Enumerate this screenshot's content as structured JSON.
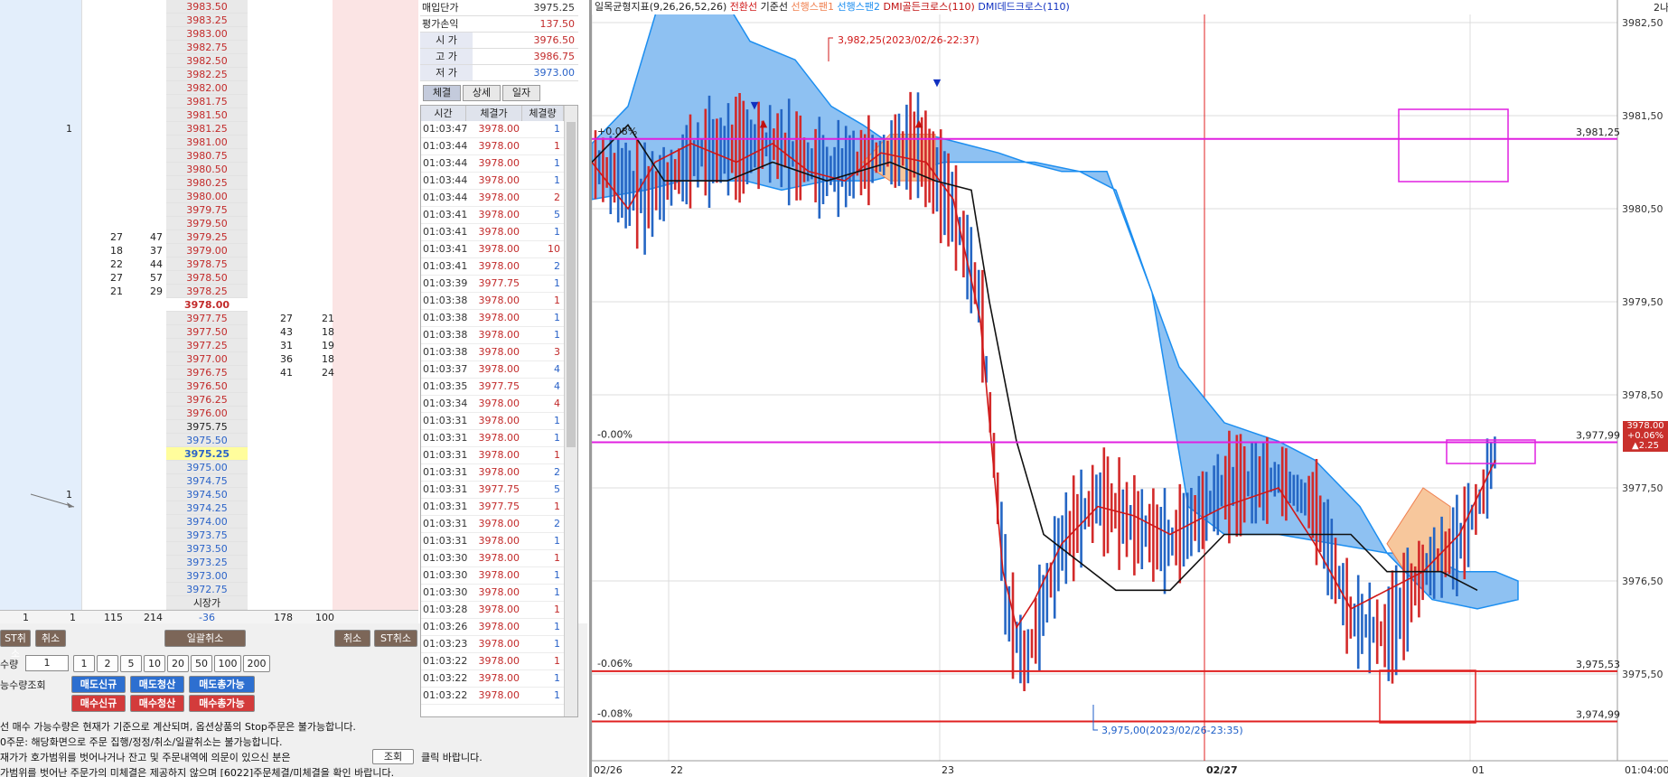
{
  "book": {
    "rows": [
      {
        "price": "3983.50",
        "cls": "ask"
      },
      {
        "price": "3983.25",
        "cls": "ask"
      },
      {
        "price": "3983.00",
        "cls": "ask"
      },
      {
        "price": "3982.75",
        "cls": "ask"
      },
      {
        "price": "3982.50",
        "cls": "ask"
      },
      {
        "price": "3982.25",
        "cls": "ask"
      },
      {
        "price": "3982.00",
        "cls": "ask"
      },
      {
        "price": "3981.75",
        "cls": "ask"
      },
      {
        "price": "3981.50",
        "cls": "ask"
      },
      {
        "price": "3981.25",
        "cls": "ask",
        "a": "1"
      },
      {
        "price": "3981.00",
        "cls": "ask"
      },
      {
        "price": "3980.75",
        "cls": "ask"
      },
      {
        "price": "3980.50",
        "cls": "ask"
      },
      {
        "price": "3980.25",
        "cls": "ask"
      },
      {
        "price": "3980.00",
        "cls": "ask"
      },
      {
        "price": "3979.75",
        "cls": "ask"
      },
      {
        "price": "3979.50",
        "cls": "ask"
      },
      {
        "price": "3979.25",
        "cls": "ask",
        "c": "27",
        "d": "47"
      },
      {
        "price": "3979.00",
        "cls": "ask",
        "c": "18",
        "d": "37"
      },
      {
        "price": "3978.75",
        "cls": "ask",
        "c": "22",
        "d": "44"
      },
      {
        "price": "3978.50",
        "cls": "ask",
        "c": "27",
        "d": "57"
      },
      {
        "price": "3978.25",
        "cls": "ask",
        "c": "21",
        "d": "29"
      },
      {
        "price": "3978.00",
        "cls": "cur"
      },
      {
        "price": "3977.75",
        "cls": "ask",
        "e": "27",
        "f": "21"
      },
      {
        "price": "3977.50",
        "cls": "ask",
        "e": "43",
        "f": "18"
      },
      {
        "price": "3977.25",
        "cls": "ask",
        "e": "31",
        "f": "19"
      },
      {
        "price": "3977.00",
        "cls": "ask",
        "e": "36",
        "f": "18"
      },
      {
        "price": "3976.75",
        "cls": "ask",
        "e": "41",
        "f": "24"
      },
      {
        "price": "3976.50",
        "cls": "ask"
      },
      {
        "price": "3976.25",
        "cls": "ask"
      },
      {
        "price": "3976.00",
        "cls": "ask"
      },
      {
        "price": "3975.75",
        "cls": "plain"
      },
      {
        "price": "3975.50",
        "cls": "bid"
      },
      {
        "price": "3975.25",
        "cls": "avg"
      },
      {
        "price": "3975.00",
        "cls": "bid"
      },
      {
        "price": "3974.75",
        "cls": "bid"
      },
      {
        "price": "3974.50",
        "cls": "bid",
        "a": "1"
      },
      {
        "price": "3974.25",
        "cls": "bid"
      },
      {
        "price": "3974.00",
        "cls": "bid"
      },
      {
        "price": "3973.75",
        "cls": "bid"
      },
      {
        "price": "3973.50",
        "cls": "bid"
      },
      {
        "price": "3973.25",
        "cls": "bid"
      },
      {
        "price": "3973.00",
        "cls": "bid"
      },
      {
        "price": "3972.75",
        "cls": "bid"
      },
      {
        "price": "시장가",
        "cls": "plain"
      }
    ],
    "totals": {
      "a": "1",
      "b": "1",
      "c": "115",
      "d": "214",
      "price": "-36",
      "e": "178",
      "f": "100"
    },
    "colors": {
      "ask": "#c22a2a",
      "bid": "#2b63c8",
      "avg_bg": "#fffd9c",
      "cur": "#c22a2a"
    }
  },
  "quote": {
    "rows": [
      {
        "k": "매입단가",
        "v": "3975.25",
        "color": "#333",
        "plainkey": true
      },
      {
        "k": "평가손익",
        "v": "137.50",
        "color": "#c22a2a",
        "plainkey": true
      },
      {
        "k": "시  가",
        "v": "3976.50",
        "color": "#c22a2a"
      },
      {
        "k": "고  가",
        "v": "3986.75",
        "color": "#c22a2a"
      },
      {
        "k": "저  가",
        "v": "3973.00",
        "color": "#2b63c8"
      }
    ],
    "tabs": [
      "체결",
      "상세",
      "일자"
    ]
  },
  "ticks": {
    "headers": [
      "시간",
      "체결가",
      "체결량"
    ],
    "rows": [
      [
        "01:03:47",
        "3978.00",
        "1"
      ],
      [
        "01:03:44",
        "3978.00",
        "1"
      ],
      [
        "01:03:44",
        "3978.00",
        "1"
      ],
      [
        "01:03:44",
        "3978.00",
        "1"
      ],
      [
        "01:03:44",
        "3978.00",
        "2"
      ],
      [
        "01:03:41",
        "3978.00",
        "5"
      ],
      [
        "01:03:41",
        "3978.00",
        "1"
      ],
      [
        "01:03:41",
        "3978.00",
        "10"
      ],
      [
        "01:03:41",
        "3978.00",
        "2"
      ],
      [
        "01:03:39",
        "3977.75",
        "1"
      ],
      [
        "01:03:38",
        "3978.00",
        "1"
      ],
      [
        "01:03:38",
        "3978.00",
        "1"
      ],
      [
        "01:03:38",
        "3978.00",
        "1"
      ],
      [
        "01:03:38",
        "3978.00",
        "3"
      ],
      [
        "01:03:37",
        "3978.00",
        "4"
      ],
      [
        "01:03:35",
        "3977.75",
        "4"
      ],
      [
        "01:03:34",
        "3978.00",
        "4"
      ],
      [
        "01:03:31",
        "3978.00",
        "1"
      ],
      [
        "01:03:31",
        "3978.00",
        "1"
      ],
      [
        "01:03:31",
        "3978.00",
        "1"
      ],
      [
        "01:03:31",
        "3978.00",
        "2"
      ],
      [
        "01:03:31",
        "3977.75",
        "5"
      ],
      [
        "01:03:31",
        "3977.75",
        "1"
      ],
      [
        "01:03:31",
        "3978.00",
        "2"
      ],
      [
        "01:03:31",
        "3978.00",
        "1"
      ],
      [
        "01:03:30",
        "3978.00",
        "1"
      ],
      [
        "01:03:30",
        "3978.00",
        "1"
      ],
      [
        "01:03:30",
        "3978.00",
        "1"
      ],
      [
        "01:03:28",
        "3978.00",
        "1"
      ],
      [
        "01:03:26",
        "3978.00",
        "1"
      ],
      [
        "01:03:23",
        "3978.00",
        "1"
      ],
      [
        "01:03:22",
        "3978.00",
        "1"
      ],
      [
        "01:03:22",
        "3978.00",
        "1"
      ],
      [
        "01:03:22",
        "3978.00",
        "1"
      ]
    ],
    "blue_vols": [
      "1",
      "1",
      "1",
      "1",
      "2",
      "5",
      "1",
      "10",
      "2",
      "1",
      "1",
      "1",
      "1",
      "3",
      "4",
      "4",
      "4",
      "1",
      "1",
      "1",
      "2",
      "5",
      "1",
      "2",
      "1",
      "1",
      "1",
      "1",
      "1",
      "1",
      "1",
      "1",
      "1",
      "1"
    ]
  },
  "controls": {
    "cancel_st_left": "ST취소",
    "cancel_left": "취소",
    "cancel_all": "일괄취소",
    "cancel_right": "취소",
    "cancel_st_right": "ST취소",
    "qty_label": "수량",
    "qty_value": "1",
    "qty_presets": [
      "1",
      "2",
      "5",
      "10",
      "20",
      "50",
      "100",
      "200"
    ],
    "avail_label": "능수량조회",
    "sell_new": "매도신규",
    "sell_close": "매도청산",
    "sell_avail": "매도총가능",
    "buy_new": "매수신규",
    "buy_close": "매수청산",
    "buy_avail": "매수총가능",
    "lookup": "조회",
    "notes": [
      "선 매수 가능수량은 현재가 기준으로 계산되며, 옵션상품의 Stop주문은 불가능합니다.",
      "0주문: 해당화면으로 주문 집행/정정/취소/일괄취소는 불가능합니다.",
      "재가가 호가범위를 벗어나거나 잔고 및 주문내역에 의문이 있으신 분은",
      "클릭 바랍니다.",
      "가범위를 벗어난 주문가의 미체결은 제공하지 않으며 [6022]주문체결/미체결을 확인 바랍니다."
    ]
  },
  "chart": {
    "legend": {
      "prefix": "일목균형지표(9,26,26,52,26)",
      "items": [
        {
          "label": "전환선",
          "color": "#d01818"
        },
        {
          "label": "기준선",
          "color": "#111111"
        },
        {
          "label": "선행스팬1",
          "color": "#f08050"
        },
        {
          "label": "선행스팬2",
          "color": "#1c8ef0"
        }
      ],
      "dmi_gold": "DMI골든크로스(110)",
      "dmi_dead": "DMI데드크로스(110)",
      "dmi_gold_color": "#c01010",
      "dmi_dead_color": "#1030c0"
    },
    "y_ticks": [
      "3982,50",
      "3981,50",
      "3980,50",
      "3979,50",
      "3978,50",
      "3977,50",
      "3976,50",
      "3975,50"
    ],
    "x_ticks": [
      "02/26",
      "22",
      "23",
      "02/27",
      "01"
    ],
    "x_corner": "01:04:00",
    "hlines": [
      {
        "pct": "+0.08%",
        "val": "3,981,25",
        "color": "#e020e0"
      },
      {
        "pct": "-0.00%",
        "val": "3,977,99",
        "color": "#e020e0"
      },
      {
        "pct": "-0.06%",
        "val": "3,975,53",
        "color": "#e02020"
      },
      {
        "pct": "-0.08%",
        "val": "3,974,99",
        "color": "#e02020"
      }
    ],
    "annot_high": "3,982,25(2023/02/26-22:37)",
    "annot_low": "3,975,00(2023/02/26-23:35)",
    "price_box": {
      "price": "3978.00",
      "chg": "+0.06%",
      "diff": "▲2.25"
    },
    "top_right": "2나"
  }
}
